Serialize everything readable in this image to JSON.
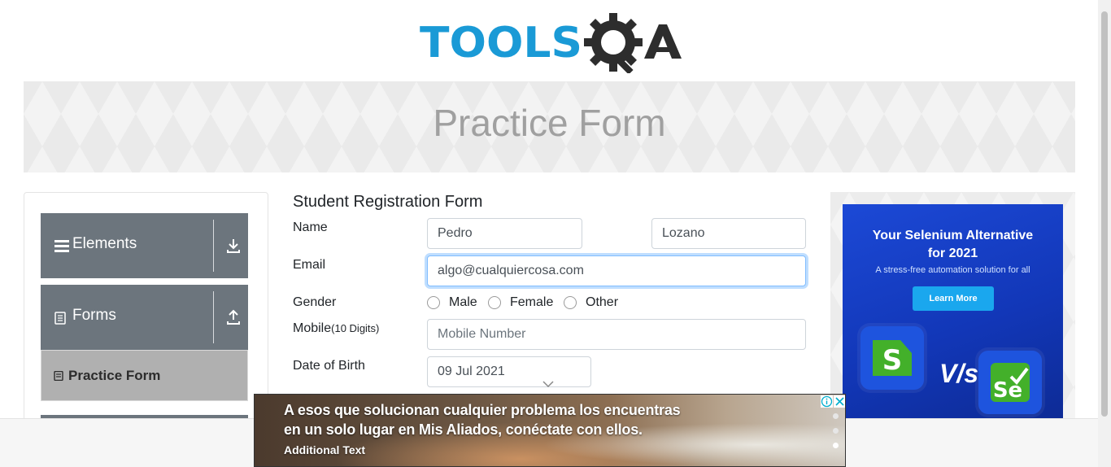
{
  "logo": {
    "text_main": "TOOLS",
    "text_qa": "QA"
  },
  "banner": {
    "title": "Practice Form"
  },
  "sidebar": {
    "groups": [
      {
        "label": "Elements",
        "icon": "hamburger-icon",
        "toggle_icon": "download-arrow-icon"
      },
      {
        "label": "Forms",
        "icon": "document-icon",
        "toggle_icon": "upload-arrow-icon"
      }
    ],
    "active_item": {
      "label": "Practice Form",
      "icon": "form-icon"
    }
  },
  "form": {
    "title": "Student Registration Form",
    "name_label": "Name",
    "first_name_value": "Pedro",
    "last_name_value": "Lozano",
    "email_label": "Email",
    "email_value": "algo@cualquiercosa.com",
    "gender_label": "Gender",
    "gender_options": [
      "Male",
      "Female",
      "Other"
    ],
    "mobile_label": "Mobile",
    "mobile_hint": "(10 Digits)",
    "mobile_placeholder": "Mobile Number",
    "dob_label": "Date of Birth",
    "dob_value": "09 Jul 2021"
  },
  "side_ad": {
    "headline_1": "Your Selenium Alternative",
    "headline_2": "for 2021",
    "sub": "A stress-free automation solution for all",
    "cta": "Learn More",
    "vs": "V/s",
    "colors": {
      "bg": "#1c49d6",
      "button": "#1aa7ee",
      "brand_green": "#43b02a"
    }
  },
  "popup_ad": {
    "line1": "A esos que solucionan cualquier problema los encuentras",
    "line2": "en un solo lugar en Mis Aliados, conéctate con ellos.",
    "extra": "Additional Text"
  },
  "colors": {
    "logo_blue": "#1a9ad6",
    "logo_dark": "#2d2d2d",
    "sidebar_group": "#6c757d",
    "active_item": "#b0b0b0"
  }
}
